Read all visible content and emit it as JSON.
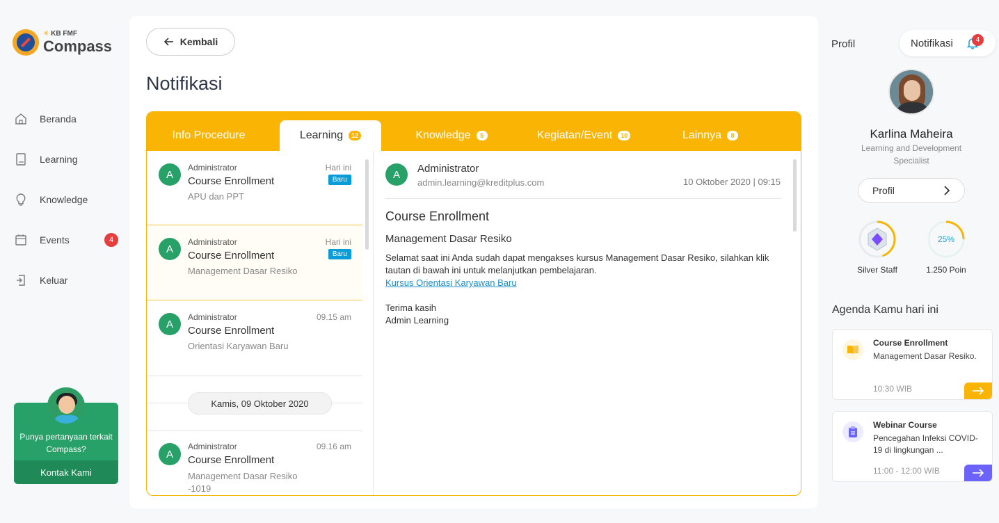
{
  "sidebar": {
    "logo": {
      "small": "KB FMF",
      "big": "Compass"
    },
    "items": [
      {
        "label": "Beranda",
        "icon": "home-icon"
      },
      {
        "label": "Learning",
        "icon": "book-icon"
      },
      {
        "label": "Knowledge",
        "icon": "lightbulb-icon"
      },
      {
        "label": "Events",
        "icon": "calendar-icon",
        "badge": "4"
      },
      {
        "label": "Keluar",
        "icon": "logout-icon"
      }
    ],
    "help": {
      "text": "Punya pertanyaan terkait Compass?",
      "button": "Kontak Kami"
    }
  },
  "main": {
    "back_label": "Kembali",
    "title": "Notifikasi",
    "tabs": [
      {
        "label": "Info Procedure",
        "badge": ""
      },
      {
        "label": "Learning",
        "badge": "12",
        "active": true
      },
      {
        "label": "Knowledge",
        "badge": "5"
      },
      {
        "label": "Kegiatan/Event",
        "badge": "10"
      },
      {
        "label": "Lainnya",
        "badge": "8"
      }
    ],
    "list": [
      {
        "avatar": "A",
        "sender": "Administrator",
        "title": "Course Enrollment",
        "sub": "APU dan PPT",
        "time": "Hari ini",
        "badge": "Baru"
      },
      {
        "avatar": "A",
        "sender": "Administrator",
        "title": "Course Enrollment",
        "sub": "Management Dasar Resiko",
        "time": "Hari ini",
        "badge": "Baru"
      },
      {
        "avatar": "A",
        "sender": "Administrator",
        "title": "Course Enrollment",
        "sub": "Orientasi Karyawan Baru",
        "time": "09.15 am",
        "badge": ""
      },
      {
        "avatar": "A",
        "sender": "Administrator",
        "title": "Course Enrollment",
        "sub": "Management Dasar Resiko -1019",
        "time": "09.16 am",
        "badge": ""
      }
    ],
    "date_separator": "Kamis, 09 Oktober 2020",
    "detail": {
      "avatar": "A",
      "sender": "Administrator",
      "email": "admin.learning@kreditplus.com",
      "date": "10 Oktober 2020 | 09:15",
      "title": "Course Enrollment",
      "subtitle": "Management Dasar Resiko",
      "body": "Selamat saat ini Anda sudah dapat mengakses kursus Management Dasar Resiko, silahkan klik tautan di bawah ini untuk melanjutkan pembelajaran.",
      "link": "Kursus Orientasi Karyawan Baru",
      "thanks": "Terima kasih",
      "signature": "Admin Learning"
    }
  },
  "right": {
    "profil_label": "Profil",
    "notif_label": "Notifikasi",
    "notif_count": "4",
    "name": "Karlina Maheira",
    "role": "Learning and Development Specialist",
    "profil_button": "Profil",
    "level_label": "Silver Staff",
    "level_progress": 0.45,
    "points_percent": "25%",
    "points_progress": 0.25,
    "points_label": "1.250 Poin",
    "agenda_title": "Agenda Kamu hari ini",
    "agenda": [
      {
        "title": "Course Enrollment",
        "desc": "Management Dasar Resiko.",
        "time": "10:30 WIB",
        "icon": "book-open-icon",
        "accent": "#f9b404"
      },
      {
        "title": "Webinar Course",
        "desc": "Pencegahan Infeksi COVID-19 di lingkungan ...",
        "time": "11:00 - 12:00 WIB",
        "icon": "clipboard-icon",
        "accent": "#6c63ff"
      }
    ]
  },
  "colors": {
    "accent": "#f9b404",
    "green": "#27a167",
    "badge_blue": "#0a9bd9",
    "red": "#e53e3e",
    "purple": "#6c63ff"
  }
}
